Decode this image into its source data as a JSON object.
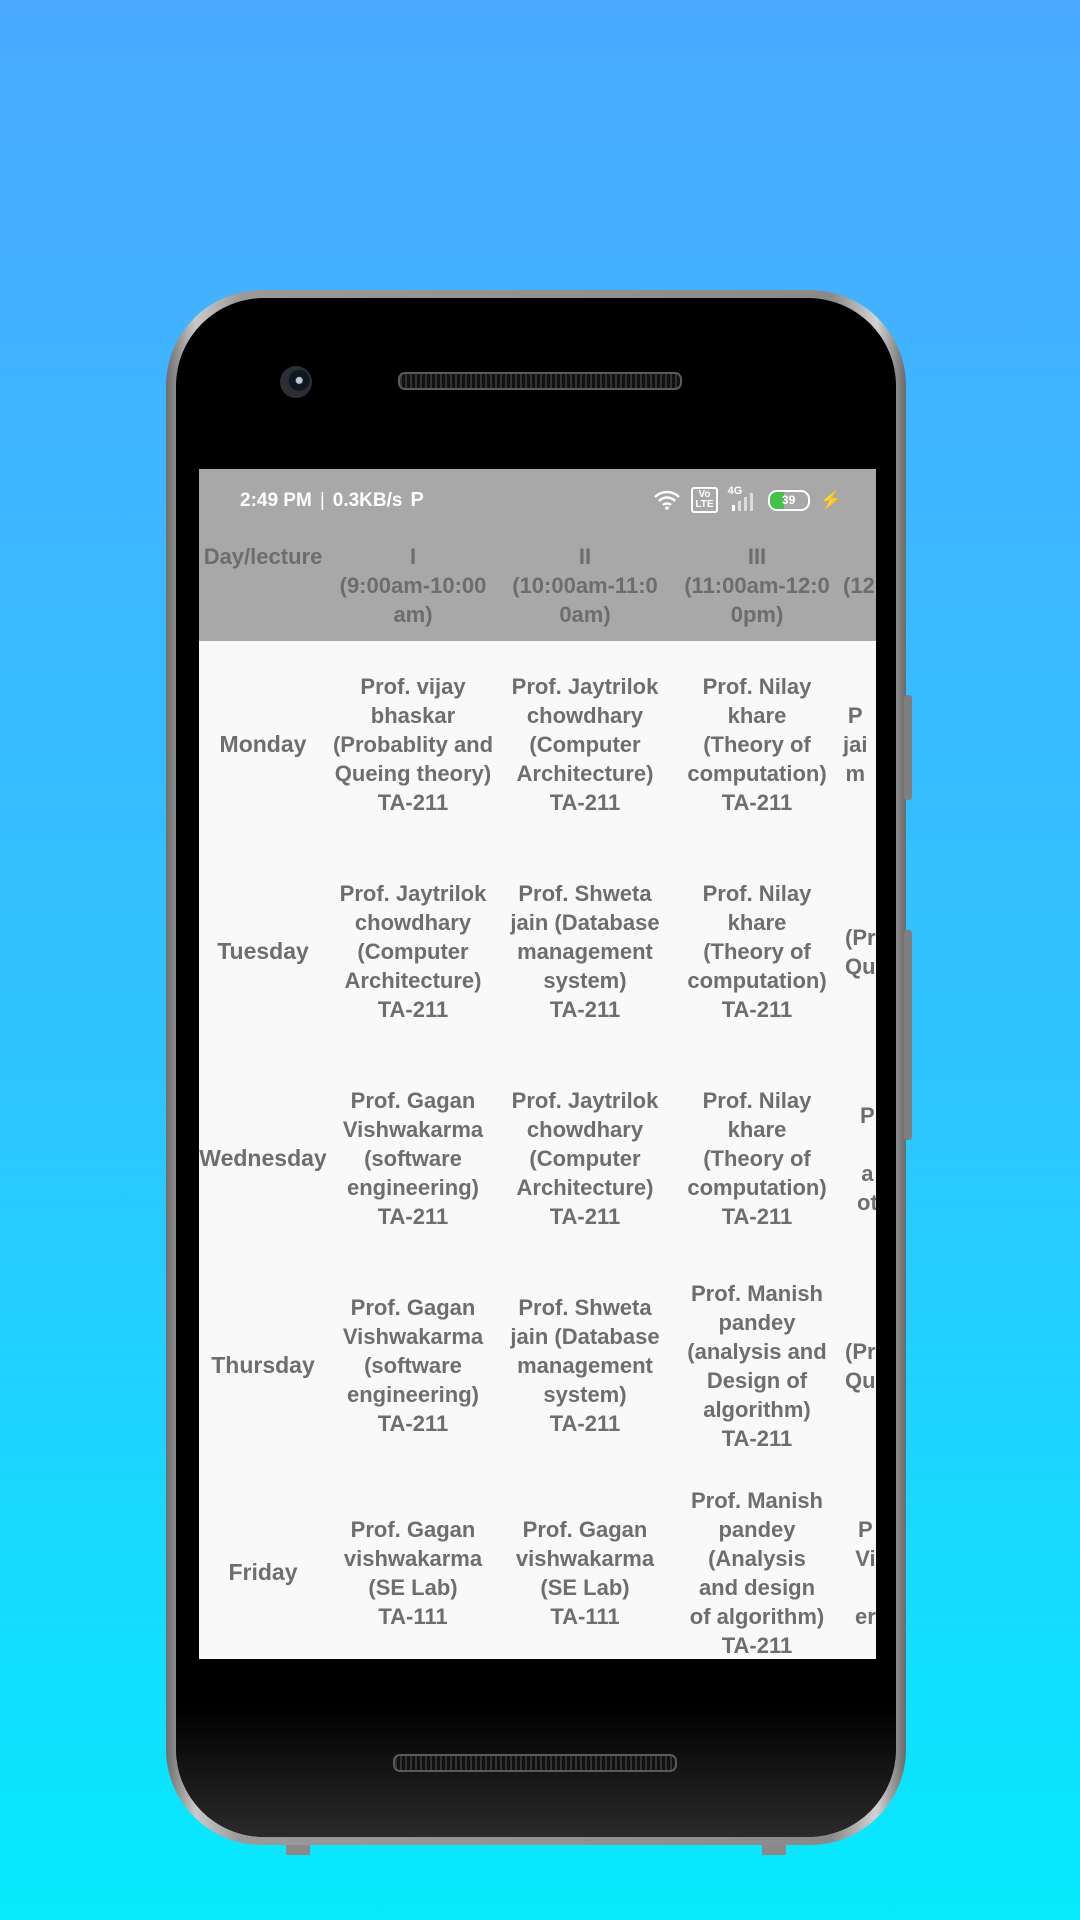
{
  "status_bar": {
    "time": "2:49 PM",
    "separator": "|",
    "network_speed": "0.3KB/s",
    "app_icon": "P",
    "volte_label": "Vo\nLTE",
    "network_type": "4G",
    "battery_level": "39",
    "battery_fraction": 0.39,
    "icons": [
      "wifi-icon",
      "volte-icon",
      "signal-icon",
      "battery-icon",
      "charging-bolt-icon"
    ]
  },
  "timetable": {
    "headers": [
      "Day/lecture",
      "I\n(9:00am-10:00\nam)",
      "II\n(10:00am-11:0\n0am)",
      "III\n(11:00am-12:0\n0pm)",
      "(12"
    ],
    "rows": [
      {
        "day": "Monday",
        "lectures": [
          "Prof. vijay\nbhaskar\n(Probablity and\nQueing theory)\nTA-211",
          "Prof. Jaytrilok\nchowdhary\n(Computer\nArchitecture)\nTA-211",
          "Prof. Nilay\nkhare\n(Theory of\ncomputation)\nTA-211",
          "P\njai\nm"
        ]
      },
      {
        "day": "Tuesday",
        "lectures": [
          "Prof. Jaytrilok\nchowdhary\n(Computer\nArchitecture)\nTA-211",
          "Prof. Shweta\njain (Database\nmanagement\nsystem)\nTA-211",
          "Prof. Nilay\nkhare\n(Theory of\ncomputation)\nTA-211",
          "(Pr\nQu"
        ]
      },
      {
        "day": "Wednesday",
        "lectures": [
          "Prof. Gagan\nVishwakarma\n(software\nengineering)\nTA-211",
          "Prof. Jaytrilok\nchowdhary\n(Computer\nArchitecture)\nTA-211",
          "Prof. Nilay\nkhare\n(Theory of\ncomputation)\nTA-211",
          "P\n\na\not"
        ]
      },
      {
        "day": "Thursday",
        "lectures": [
          "Prof. Gagan\nVishwakarma\n(software\nengineering)\nTA-211",
          "Prof. Shweta\njain (Database\nmanagement\nsystem)\nTA-211",
          "Prof. Manish\npandey\n(analysis and\nDesign of\nalgorithm)\nTA-211",
          "(Pr\nQu"
        ]
      },
      {
        "day": "Friday",
        "lectures": [
          "Prof. Gagan\nvishwakarma\n(SE Lab)\nTA-111",
          "Prof. Gagan\nvishwakarma\n(SE Lab)\nTA-111",
          "Prof. Manish\npandey\n(Analysis\nand design\nof algorithm)\nTA-211",
          "P\nVi\n\ner"
        ]
      }
    ]
  }
}
